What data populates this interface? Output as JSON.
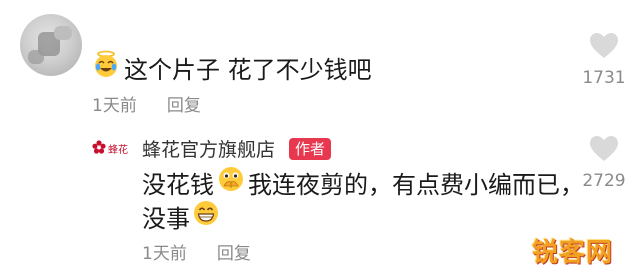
{
  "comments": [
    {
      "text": "这个片子 花了不少钱吧",
      "emoji_icon": "crying-laughing-angel-emoji-icon",
      "time": "1天前",
      "reply_label": "回复",
      "likes": "1731"
    },
    {
      "author": "蜂花官方旗舰店",
      "author_tag": "作者",
      "brand_logo_text": "蜂花",
      "text_part1": "没花钱",
      "emoji1_icon": "praying-emoji-icon",
      "text_part2": "我连夜剪的，有点费小编而已，",
      "text_part3": "没事",
      "emoji2_icon": "grinning-emoji-icon",
      "time": "1天前",
      "reply_label": "回复",
      "likes": "2729"
    }
  ],
  "watermark": "锐客网",
  "colors": {
    "author_tag_bg": "#e8384f",
    "meta_text": "#8a8a8a",
    "like_icon": "#d9d9d9",
    "brand_red": "#c8102e"
  }
}
